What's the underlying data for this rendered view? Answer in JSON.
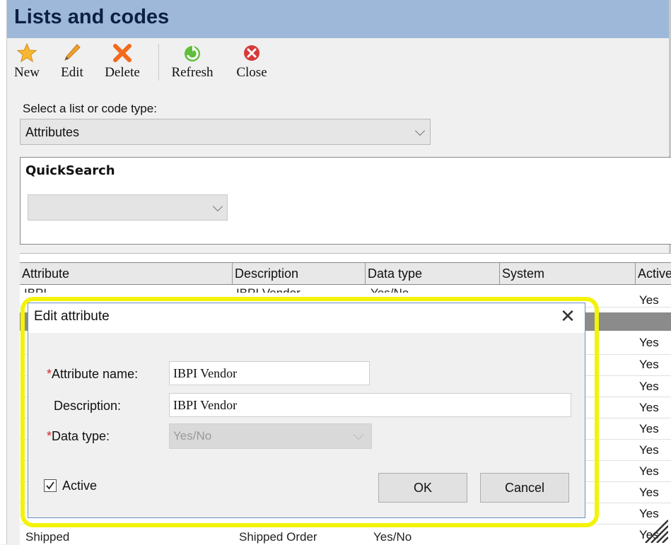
{
  "window": {
    "title": "Lists and codes"
  },
  "toolbar": {
    "new": "New",
    "edit": "Edit",
    "delete": "Delete",
    "refresh": "Refresh",
    "close": "Close"
  },
  "list_select": {
    "label": "Select a list or code type:",
    "value": "Attributes"
  },
  "quicksearch": {
    "title": "QuickSearch",
    "value": ""
  },
  "table": {
    "columns": [
      "Attribute",
      "Description",
      "Data type",
      "System",
      "Active"
    ],
    "active_values": [
      "Yes",
      "Yes",
      "Yes",
      "Yes",
      "Yes",
      "Yes",
      "Yes",
      "Yes",
      "Yes",
      "Yes",
      "Yes"
    ],
    "partial_row_top": {
      "attribute": "IBPI",
      "description": "IBPI Vendor",
      "data_type": "Yes/No"
    },
    "last_row": {
      "attribute": "Shipped",
      "description": "Shipped Order",
      "data_type": "Yes/No",
      "active": "Yes"
    }
  },
  "dialog": {
    "title": "Edit attribute",
    "close_glyph": "✕",
    "required_mark": "*",
    "attribute_name_label": "Attribute name:",
    "attribute_name_value": "IBPI Vendor",
    "description_label": "Description:",
    "description_value": "IBPI Vendor",
    "data_type_label": "Data type:",
    "data_type_value": "Yes/No",
    "active_label": "Active",
    "active_checked": true,
    "ok_label": "OK",
    "cancel_label": "Cancel"
  },
  "icons": {
    "new": "star-icon",
    "edit": "pencil-icon",
    "delete": "x-icon",
    "refresh": "refresh-icon",
    "close": "close-circle-icon"
  },
  "colors": {
    "title_bar": "#9db8d8",
    "title_text": "#0c1f44",
    "highlight": "#f3f30a",
    "required": "#dd2222"
  }
}
